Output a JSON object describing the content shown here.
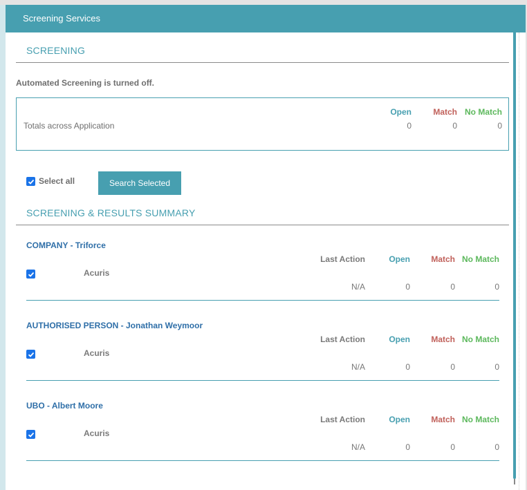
{
  "panel": {
    "title": "Screening Services"
  },
  "screening": {
    "section_title": "SCREENING",
    "notice": "Automated Screening is turned off.",
    "totals": {
      "label": "Totals across Application",
      "headers": {
        "open": "Open",
        "match": "Match",
        "no_match": "No Match"
      },
      "values": {
        "open": "0",
        "match": "0",
        "no_match": "0"
      }
    }
  },
  "controls": {
    "select_all_label": "Select all",
    "select_all_checked": true,
    "search_button_label": "Search Selected"
  },
  "summary": {
    "section_title": "SCREENING & RESULTS SUMMARY",
    "headers": {
      "last_action": "Last Action",
      "open": "Open",
      "match": "Match",
      "no_match": "No Match"
    },
    "entities": [
      {
        "title": "COMPANY - Triforce",
        "provider": "Acuris",
        "checked": true,
        "last_action": "N/A",
        "open": "0",
        "match": "0",
        "no_match": "0"
      },
      {
        "title": "AUTHORISED PERSON - Jonathan Weymoor",
        "provider": "Acuris",
        "checked": true,
        "last_action": "N/A",
        "open": "0",
        "match": "0",
        "no_match": "0"
      },
      {
        "title": "UBO - Albert Moore",
        "provider": "Acuris",
        "checked": true,
        "last_action": "N/A",
        "open": "0",
        "match": "0",
        "no_match": "0"
      }
    ]
  },
  "colors": {
    "accent": "#479fb0",
    "open": "#479fb0",
    "match": "#c0605a",
    "no_match": "#5cb85c",
    "entity_title": "#2f6fa8"
  }
}
